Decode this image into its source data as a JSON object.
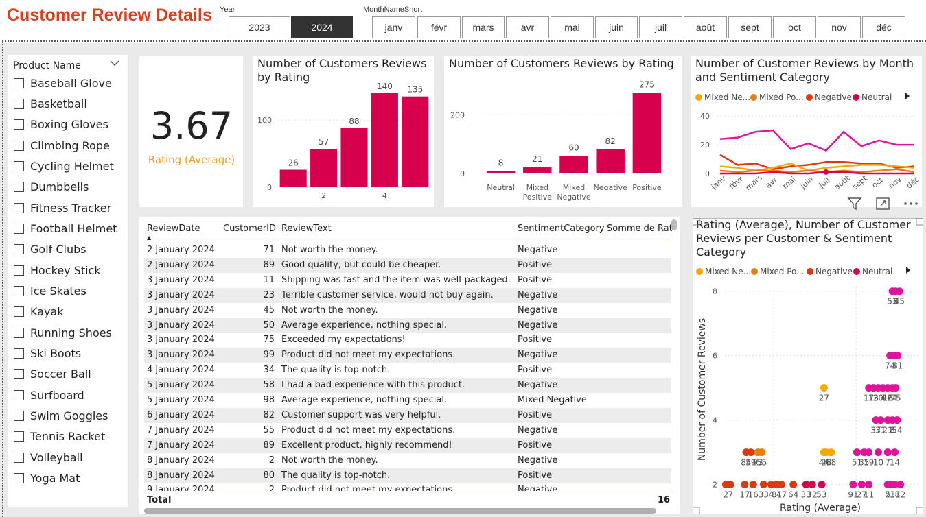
{
  "header": {
    "title": "Customer Review Details"
  },
  "year_slicer": {
    "label": "Year",
    "options": [
      "2023",
      "2024"
    ],
    "selected": "2024"
  },
  "month_slicer": {
    "label": "MonthNameShort",
    "options": [
      "janv",
      "févr",
      "mars",
      "avr",
      "mai",
      "juin",
      "juil",
      "août",
      "sept",
      "oct",
      "nov",
      "déc"
    ]
  },
  "product_slicer": {
    "title": "Product Name",
    "items": [
      "Baseball Glove",
      "Basketball",
      "Boxing Gloves",
      "Climbing Rope",
      "Cycling Helmet",
      "Dumbbells",
      "Fitness Tracker",
      "Football Helmet",
      "Golf Clubs",
      "Hockey Stick",
      "Ice Skates",
      "Kayak",
      "Running Shoes",
      "Ski Boots",
      "Soccer Ball",
      "Surfboard",
      "Swim Goggles",
      "Tennis Racket",
      "Volleyball",
      "Yoga Mat"
    ]
  },
  "kpi": {
    "value": "3.67",
    "label": "Rating (Average)"
  },
  "colors": {
    "accent": "#d6004c",
    "title": "#d6401c",
    "kpi_label": "#f0a030",
    "mixed_negative": "#f5a800",
    "mixed_positive": "#e87d10",
    "negative": "#d93a13",
    "neutral": "#d6004c",
    "positive": "#e0139a"
  },
  "chart_data": [
    {
      "type": "bar",
      "title": "Number of Customers Reviews by Rating",
      "categories": [
        "1",
        "2",
        "3",
        "4",
        "5"
      ],
      "tick_labels": [
        "",
        "2",
        "",
        "4",
        ""
      ],
      "values": [
        26,
        57,
        88,
        140,
        135
      ],
      "y_ticks": [
        "0",
        "100"
      ],
      "ylim": [
        0,
        150
      ]
    },
    {
      "type": "bar",
      "title": "Number of Customers Reviews by Rating",
      "categories": [
        "Neutral",
        "Mixed Positive",
        "Mixed Negative",
        "Negative",
        "Positive"
      ],
      "values": [
        8,
        21,
        60,
        82,
        275
      ],
      "y_ticks": [
        "0",
        "200"
      ],
      "ylim": [
        0,
        290
      ]
    },
    {
      "type": "line",
      "title": "Number of Customer Reviews by Month and Sentiment Category",
      "categories": [
        "janv",
        "févr",
        "mars",
        "avr",
        "mai",
        "juin",
        "juil",
        "août",
        "sept",
        "oct",
        "nov",
        "déc"
      ],
      "y_ticks": [
        "0",
        "20",
        "40"
      ],
      "ylim": [
        0,
        42
      ],
      "legend": [
        "Mixed Ne...",
        "Mixed Po...",
        "Negative",
        "Neutral"
      ],
      "series": [
        {
          "name": "Positive",
          "values": [
            24,
            25,
            29,
            30,
            17,
            21,
            16,
            29,
            19,
            23,
            20,
            20
          ]
        },
        {
          "name": "Negative",
          "values": [
            13,
            6,
            7,
            3,
            5,
            6,
            8,
            8,
            7,
            7,
            4,
            5
          ]
        },
        {
          "name": "Mixed Negative",
          "values": [
            5,
            4,
            2,
            4,
            7,
            2,
            4,
            5,
            6,
            6,
            5,
            4
          ]
        },
        {
          "name": "Mixed Positive",
          "values": [
            2,
            1,
            2,
            2,
            1,
            2,
            1,
            2,
            1,
            2,
            3,
            1
          ]
        },
        {
          "name": "Neutral",
          "values": [
            0,
            0,
            0,
            1,
            0,
            0,
            1,
            1,
            0,
            0,
            0,
            0
          ]
        }
      ]
    },
    {
      "type": "scatter",
      "title": "Rating (Average), Number of Customer Reviews per Customer & Sentiment Category",
      "xlabel": "Rating (Average)",
      "ylabel": "Number of Customer Reviews",
      "y_ticks": [
        "2",
        "4",
        "6",
        "8"
      ],
      "ylim": [
        1.8,
        8.1
      ],
      "xlim": [
        1,
        5
      ],
      "legend": [
        "Mixed Ne...",
        "Mixed Po...",
        "Negative",
        "Neutral"
      ],
      "points": [
        {
          "label": "53",
          "x": 4.55,
          "y": 8,
          "cat": "positive"
        },
        {
          "label": "6",
          "x": 4.62,
          "y": 8,
          "cat": "positive"
        },
        {
          "label": "45",
          "x": 4.7,
          "y": 8,
          "cat": "positive"
        },
        {
          "label": "74",
          "x": 4.5,
          "y": 6,
          "cat": "positive"
        },
        {
          "label": "3",
          "x": 4.58,
          "y": 6,
          "cat": "positive"
        },
        {
          "label": "81",
          "x": 4.66,
          "y": 6,
          "cat": "positive"
        },
        {
          "label": "27",
          "x": 3.1,
          "y": 5,
          "cat": "mixed_negative"
        },
        {
          "label": "17",
          "x": 4.05,
          "y": 5,
          "cat": "positive"
        },
        {
          "label": "13",
          "x": 4.15,
          "y": 5,
          "cat": "positive"
        },
        {
          "label": "20",
          "x": 4.25,
          "y": 5,
          "cat": "positive"
        },
        {
          "label": "4",
          "x": 4.35,
          "y": 5,
          "cat": "positive"
        },
        {
          "label": "16",
          "x": 4.45,
          "y": 5,
          "cat": "positive"
        },
        {
          "label": "24",
          "x": 4.55,
          "y": 5,
          "cat": "positive"
        },
        {
          "label": "75",
          "x": 4.62,
          "y": 5,
          "cat": "positive"
        },
        {
          "label": "37",
          "x": 4.2,
          "y": 4,
          "cat": "positive"
        },
        {
          "label": "31",
          "x": 4.3,
          "y": 4,
          "cat": "positive"
        },
        {
          "label": "21",
          "x": 4.45,
          "y": 4,
          "cat": "positive"
        },
        {
          "label": "8",
          "x": 4.55,
          "y": 4,
          "cat": "positive"
        },
        {
          "label": "54",
          "x": 4.65,
          "y": 4,
          "cat": "positive"
        },
        {
          "label": "59",
          "x": 1.55,
          "y": 3,
          "cat": "negative"
        },
        {
          "label": "84",
          "x": 1.45,
          "y": 3,
          "cat": "negative"
        },
        {
          "label": "93",
          "x": 1.7,
          "y": 3,
          "cat": "mixed_positive"
        },
        {
          "label": "55",
          "x": 1.78,
          "y": 3,
          "cat": "mixed_positive"
        },
        {
          "label": "44",
          "x": 3.1,
          "y": 3,
          "cat": "mixed_negative"
        },
        {
          "label": "28",
          "x": 3.15,
          "y": 3,
          "cat": "mixed_negative"
        },
        {
          "label": "68",
          "x": 3.25,
          "y": 3,
          "cat": "mixed_negative"
        },
        {
          "label": "51",
          "x": 3.8,
          "y": 3,
          "cat": "positive"
        },
        {
          "label": "35",
          "x": 3.95,
          "y": 3,
          "cat": "positive"
        },
        {
          "label": "19",
          "x": 4.05,
          "y": 3,
          "cat": "positive"
        },
        {
          "label": "10",
          "x": 4.25,
          "y": 3,
          "cat": "positive"
        },
        {
          "label": "7",
          "x": 4.45,
          "y": 3,
          "cat": "positive"
        },
        {
          "label": "14",
          "x": 4.6,
          "y": 3,
          "cat": "positive"
        },
        {
          "label": "2",
          "x": 1.02,
          "y": 2,
          "cat": "negative"
        },
        {
          "label": "7",
          "x": 1.12,
          "y": 2,
          "cat": "negative"
        },
        {
          "label": "17",
          "x": 1.42,
          "y": 2,
          "cat": "negative"
        },
        {
          "label": "16",
          "x": 1.6,
          "y": 2,
          "cat": "negative"
        },
        {
          "label": "33",
          "x": 1.82,
          "y": 2,
          "cat": "negative"
        },
        {
          "label": "4",
          "x": 1.98,
          "y": 2,
          "cat": "negative"
        },
        {
          "label": "47",
          "x": 2.2,
          "y": 2,
          "cat": "negative"
        },
        {
          "label": "81",
          "x": 2.1,
          "y": 2,
          "cat": "negative"
        },
        {
          "label": "64",
          "x": 2.45,
          "y": 2,
          "cat": "negative"
        },
        {
          "label": "33",
          "x": 2.72,
          "y": 2,
          "cat": "neutral"
        },
        {
          "label": "32",
          "x": 2.85,
          "y": 2,
          "cat": "neutral"
        },
        {
          "label": "53",
          "x": 3.05,
          "y": 2,
          "cat": "neutral"
        },
        {
          "label": "91",
          "x": 3.72,
          "y": 2,
          "cat": "positive"
        },
        {
          "label": "27",
          "x": 3.9,
          "y": 2,
          "cat": "positive"
        },
        {
          "label": "11",
          "x": 4.05,
          "y": 2,
          "cat": "positive"
        },
        {
          "label": "23",
          "x": 4.5,
          "y": 2,
          "cat": "positive"
        },
        {
          "label": "12",
          "x": 4.72,
          "y": 2,
          "cat": "positive"
        },
        {
          "label": "5",
          "x": 4.45,
          "y": 2,
          "cat": "positive"
        },
        {
          "label": "18",
          "x": 4.6,
          "y": 2,
          "cat": "positive"
        }
      ]
    }
  ],
  "table": {
    "columns": [
      "ReviewDate",
      "CustomerID",
      "ReviewText",
      "SentimentCategory",
      "Somme de Rati"
    ],
    "rows": [
      [
        "2 January 2024",
        "71",
        "Not worth the money.",
        "Negative"
      ],
      [
        "2 January 2024",
        "89",
        "Good quality, but could be cheaper.",
        "Positive"
      ],
      [
        "3 January 2024",
        "11",
        "Shipping was fast and the item was well-packaged.",
        "Positive"
      ],
      [
        "3 January 2024",
        "23",
        "Terrible customer service, would not buy again.",
        "Negative"
      ],
      [
        "3 January 2024",
        "45",
        "Not worth the money.",
        "Negative"
      ],
      [
        "3 January 2024",
        "50",
        "Average experience, nothing special.",
        "Negative"
      ],
      [
        "3 January 2024",
        "75",
        "Exceeded my expectations!",
        "Positive"
      ],
      [
        "3 January 2024",
        "99",
        "Product did not meet my expectations.",
        "Negative"
      ],
      [
        "4 January 2024",
        "34",
        "The quality is top-notch.",
        "Positive"
      ],
      [
        "5 January 2024",
        "58",
        "I had a bad experience with this product.",
        "Negative"
      ],
      [
        "5 January 2024",
        "98",
        "Average experience, nothing special.",
        "Mixed Negative"
      ],
      [
        "6 January 2024",
        "82",
        "Customer support was very helpful.",
        "Positive"
      ],
      [
        "7 January 2024",
        "55",
        "Product did not meet my expectations.",
        "Negative"
      ],
      [
        "7 January 2024",
        "89",
        "Excellent product, highly recommend!",
        "Positive"
      ],
      [
        "8 January 2024",
        "2",
        "Not worth the money.",
        "Negative"
      ],
      [
        "8 January 2024",
        "80",
        "The quality is top-notch.",
        "Positive"
      ],
      [
        "9 January 2024",
        "2",
        "Product did not meet my expectations.",
        "Negative"
      ]
    ],
    "total_label": "Total",
    "total_value": "16"
  },
  "icons": {
    "filter": "filter-icon",
    "focus": "focus-mode-icon",
    "more": "more-options-icon",
    "sort": "sort-ascending-icon",
    "chevron": "chevron-down-icon"
  }
}
